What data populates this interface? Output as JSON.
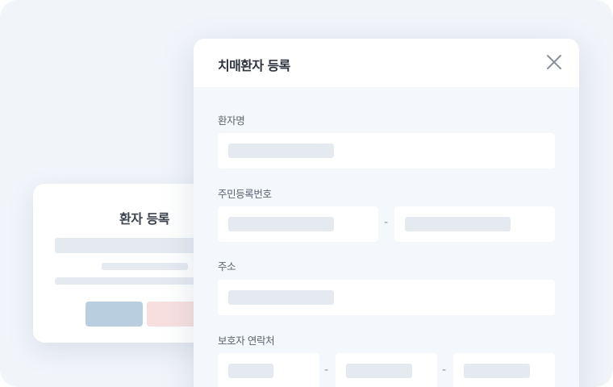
{
  "back_card": {
    "title": "환자 등록"
  },
  "modal": {
    "title": "치매환자 등록",
    "fields": {
      "name_label": "환자명",
      "rrn_label": "주민등록번호",
      "address_label": "주소",
      "guardian_label": "보호자 연락처"
    },
    "separator": "-"
  },
  "icons": {
    "close": "close-icon"
  },
  "colors": {
    "background": "#f1f4f9",
    "placeholder": "#e5eaf1",
    "confirm_button": "#b9cfe0",
    "cancel_button": "#f8dfdf"
  }
}
